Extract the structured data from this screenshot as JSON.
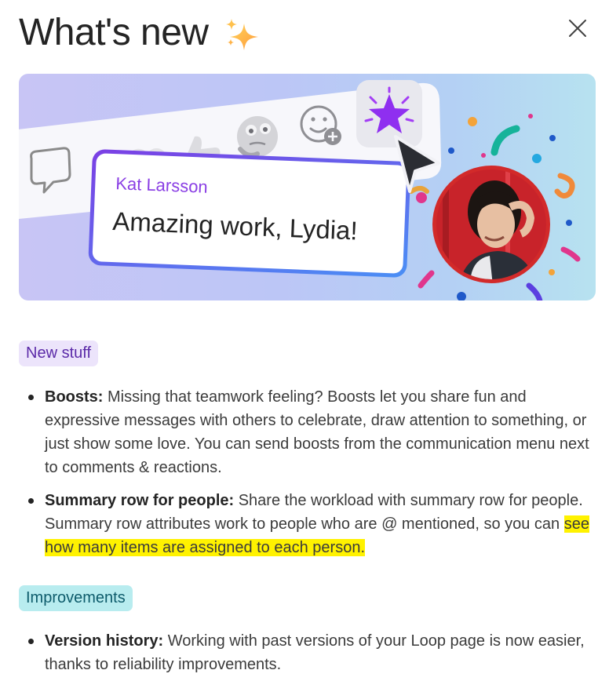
{
  "dialog": {
    "title": "What's new",
    "title_icon": "sparkle-icon",
    "close_icon": "close-icon"
  },
  "hero": {
    "card_name": "Kat Larsson",
    "card_message": "Amazing work, Lydia!",
    "accent": "#7b3fe4"
  },
  "sections": {
    "new_stuff": {
      "label": "New stuff",
      "items": [
        {
          "term": "Boosts:",
          "text": " Missing that teamwork feeling? Boosts let you share fun and expressive messages with others to celebrate, draw attention to something, or just show some love. You can send boosts from the communication menu next to comments & reactions."
        },
        {
          "term": "Summary row for people:",
          "text": " Share the workload with summary row for people. Summary row attributes work to people who are @ mentioned, so you can ",
          "highlight": "see how many items are assigned to each person."
        }
      ]
    },
    "improvements": {
      "label": "Improvements",
      "items": [
        {
          "term": "Version history:",
          "text": " Working with past versions of your Loop page is now easier, thanks to reliability improvements."
        }
      ]
    }
  },
  "colors": {
    "new_tag_bg": "#ece4fb",
    "new_tag_text": "#5b2aa8",
    "improvements_tag_bg": "#b8ecef",
    "highlight": "#fff200"
  }
}
